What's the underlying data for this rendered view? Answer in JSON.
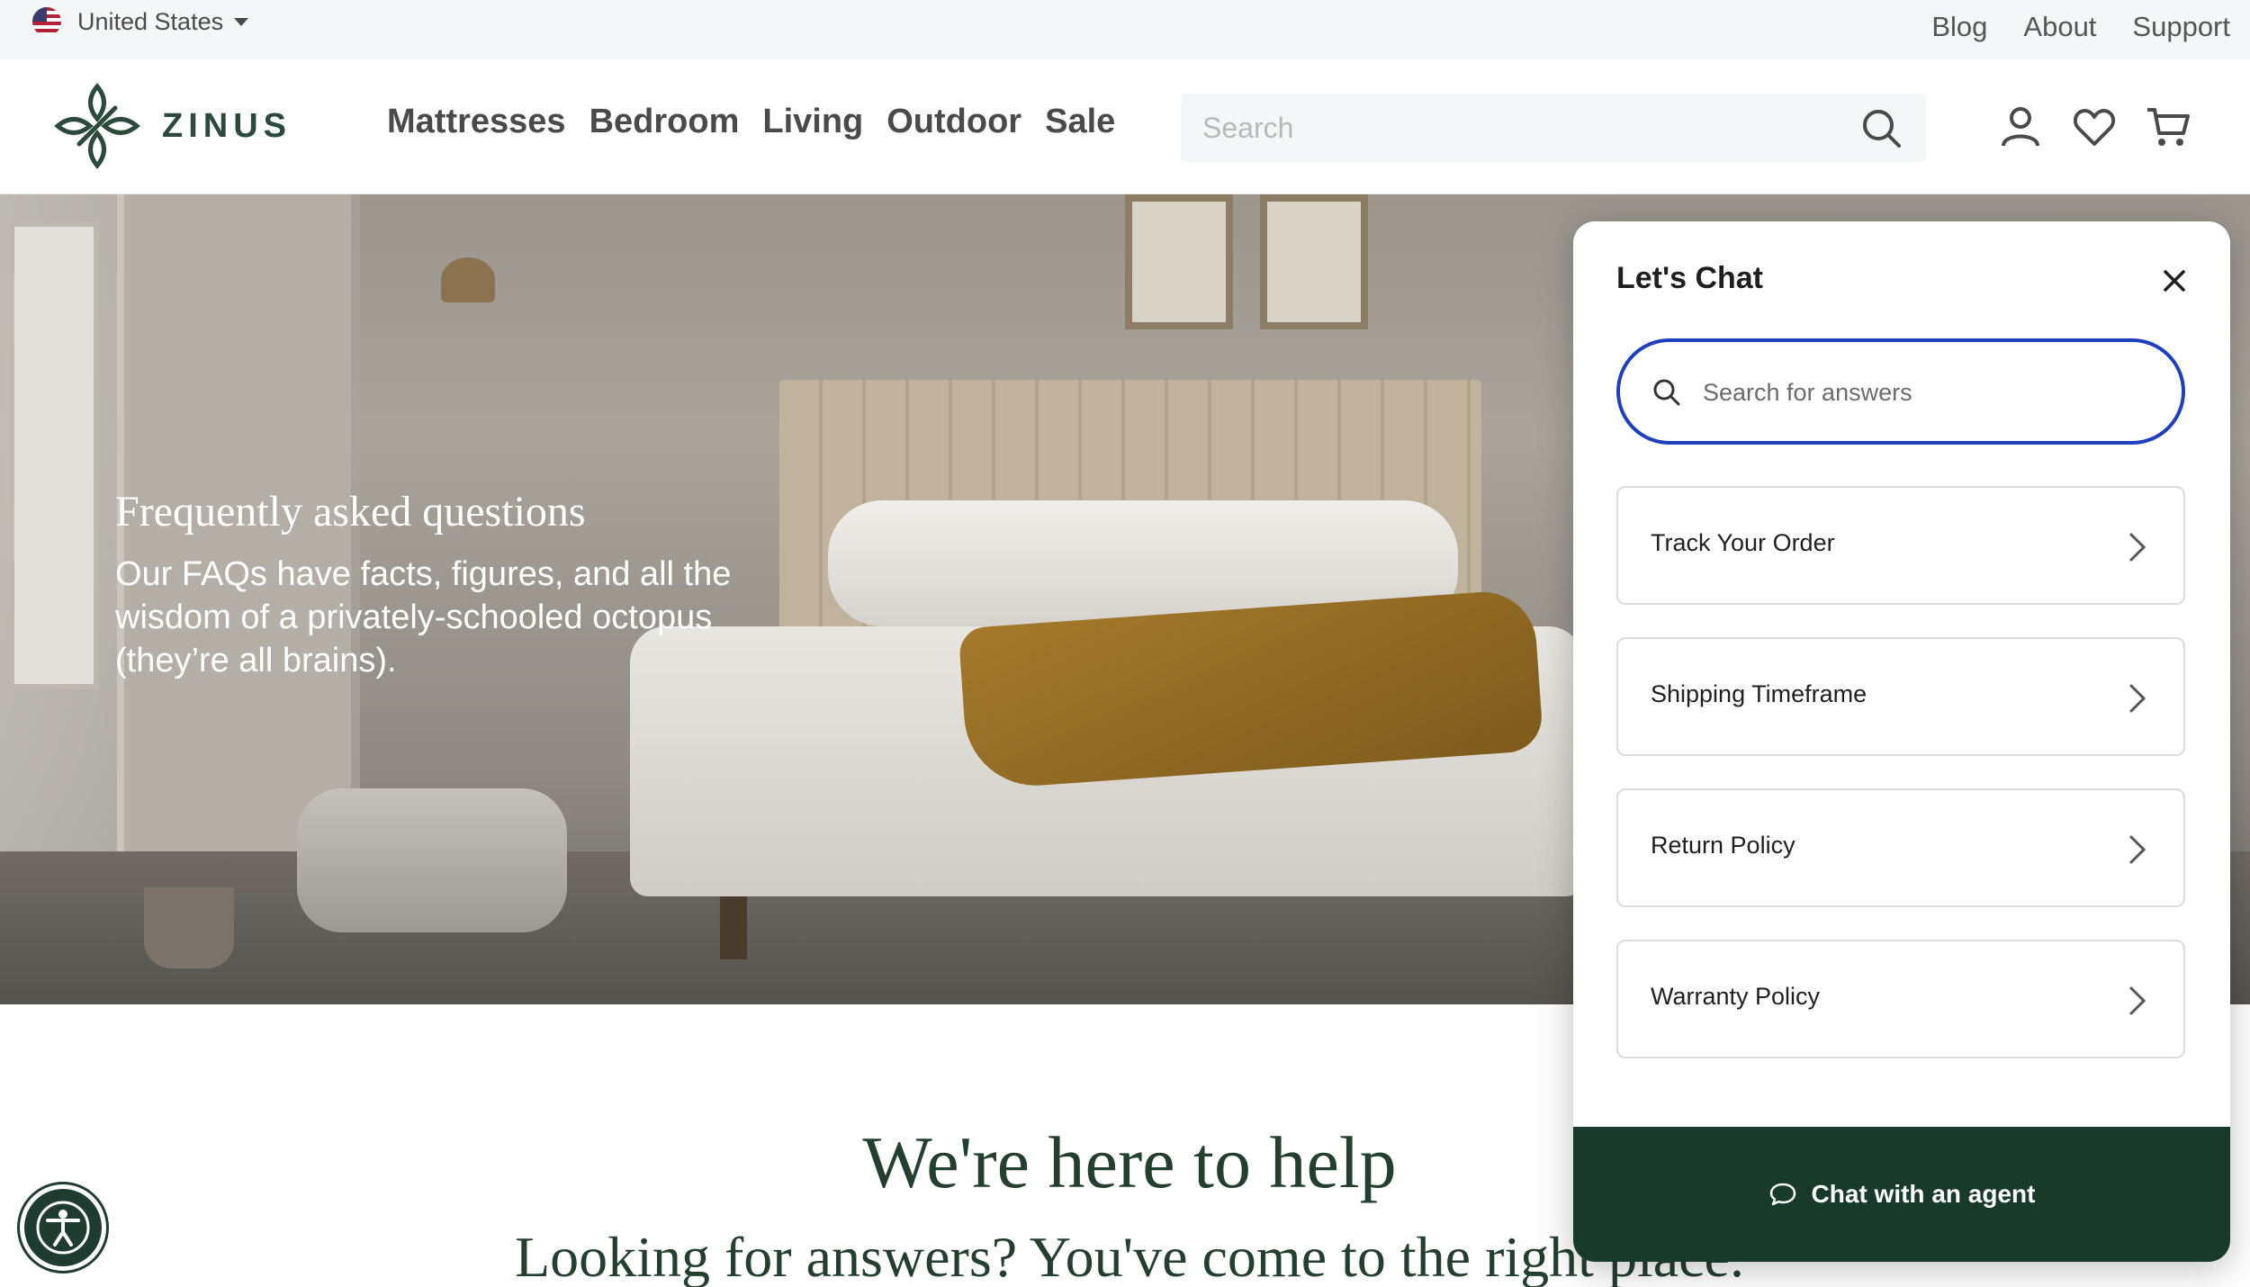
{
  "utility": {
    "country": "United States",
    "links": [
      "Blog",
      "About",
      "Support"
    ]
  },
  "header": {
    "logo_text": "ZINUS",
    "nav": [
      "Mattresses",
      "Bedroom",
      "Living",
      "Outdoor",
      "Sale"
    ],
    "search_placeholder": "Search"
  },
  "hero": {
    "title": "Frequently asked questions",
    "subtitle_lines": [
      "Our FAQs have facts, figures, and all the",
      "wisdom of a privately-schooled octopus",
      "(they’re all brains)."
    ]
  },
  "help": {
    "title": "We're here to help",
    "subtitle": "Looking for answers? You've come to the right place."
  },
  "chat": {
    "title": "Let's Chat",
    "search_placeholder": "Search for answers",
    "items": [
      "Track Your Order",
      "Shipping Timeframe",
      "Return Policy",
      "Warranty Policy"
    ],
    "agent_button": "Chat with an agent"
  },
  "colors": {
    "brand_green": "#173a2b",
    "focus_blue": "#1e3fc0",
    "heading_green": "#23402f"
  },
  "icons": [
    "us-flag-icon",
    "caret-down-icon",
    "zinus-logo-icon",
    "search-icon",
    "account-icon",
    "heart-icon",
    "cart-icon",
    "close-icon",
    "chevron-right-icon",
    "chat-bubble-icon",
    "accessibility-icon"
  ]
}
